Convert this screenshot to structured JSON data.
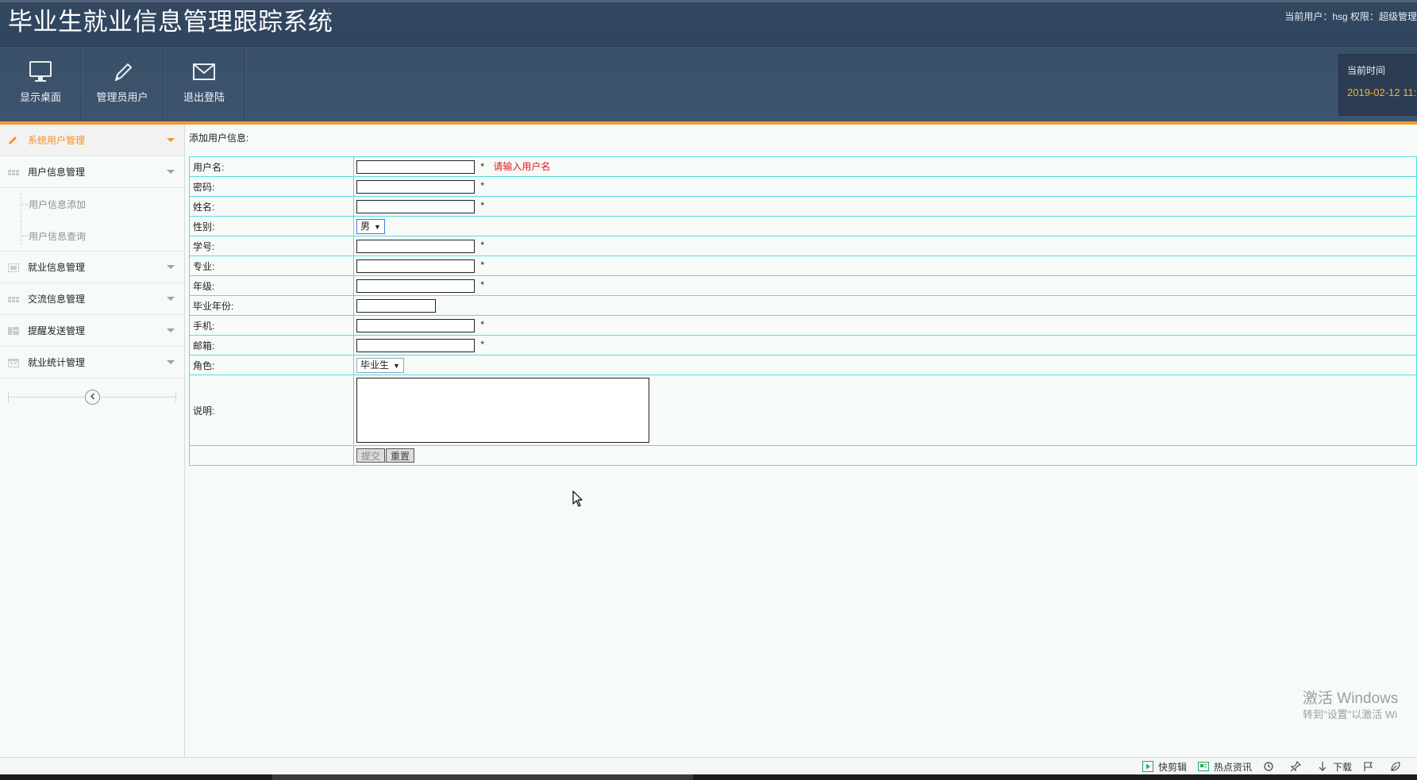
{
  "header": {
    "app_title": "毕业生就业信息管理跟踪系统",
    "user_info": "当前用户：hsg  权限：超级管理"
  },
  "toolbar": {
    "items": [
      {
        "label": "显示桌面",
        "icon": "monitor-icon"
      },
      {
        "label": "管理员用户",
        "icon": "pencil-icon"
      },
      {
        "label": "退出登陆",
        "icon": "envelope-icon"
      }
    ]
  },
  "clock": {
    "label": "当前时间",
    "value": "2019-02-12 11:"
  },
  "sidebar": {
    "items": [
      {
        "label": "系统用户管理",
        "icon": "pencil-icon",
        "active": true
      },
      {
        "label": "用户信息管理",
        "icon": "grid-icon"
      },
      {
        "label": "就业信息管理",
        "icon": "image-icon"
      },
      {
        "label": "交流信息管理",
        "icon": "grid-icon"
      },
      {
        "label": "提醒发送管理",
        "icon": "layout-icon"
      },
      {
        "label": "就业统计管理",
        "icon": "calendar-icon"
      }
    ],
    "submenu": [
      {
        "label": "用户信息添加"
      },
      {
        "label": "用户信息查询"
      }
    ]
  },
  "content": {
    "heading": "添加用户信息:",
    "form": {
      "username_label": "用户名:",
      "username_hint": "请输入用户名",
      "password_label": "密码:",
      "name_label": "姓名:",
      "gender_label": "性别:",
      "gender_value": "男",
      "student_id_label": "学号:",
      "major_label": "专业:",
      "grade_label": "年级:",
      "grad_year_label": "毕业年份:",
      "phone_label": "手机:",
      "email_label": "邮箱:",
      "role_label": "角色:",
      "role_value": "毕业生",
      "note_label": "说明:",
      "required_mark": "*",
      "submit_label": "提交",
      "reset_label": "重置"
    }
  },
  "watermark": {
    "line1": "激活 Windows",
    "line2": "转到\"设置\"以激活 Wi"
  },
  "statusbar": {
    "items": [
      {
        "label": "快剪辑",
        "icon": "play-icon",
        "color": "#2aa85a"
      },
      {
        "label": "热点资讯",
        "icon": "news-icon",
        "color": "#2aa85a"
      },
      {
        "label": "",
        "icon": "refresh-icon"
      },
      {
        "label": "",
        "icon": "pin-icon"
      },
      {
        "label": "下载",
        "icon": "download-icon"
      },
      {
        "label": "",
        "icon": "flag-icon"
      },
      {
        "label": "",
        "icon": "leaf-icon"
      }
    ]
  },
  "colors": {
    "header_bg": "#34475f",
    "accent_orange": "#f19c32",
    "table_border": "#55dcdf",
    "hint_red": "#e4181b",
    "clock_value": "#f3b33a"
  }
}
